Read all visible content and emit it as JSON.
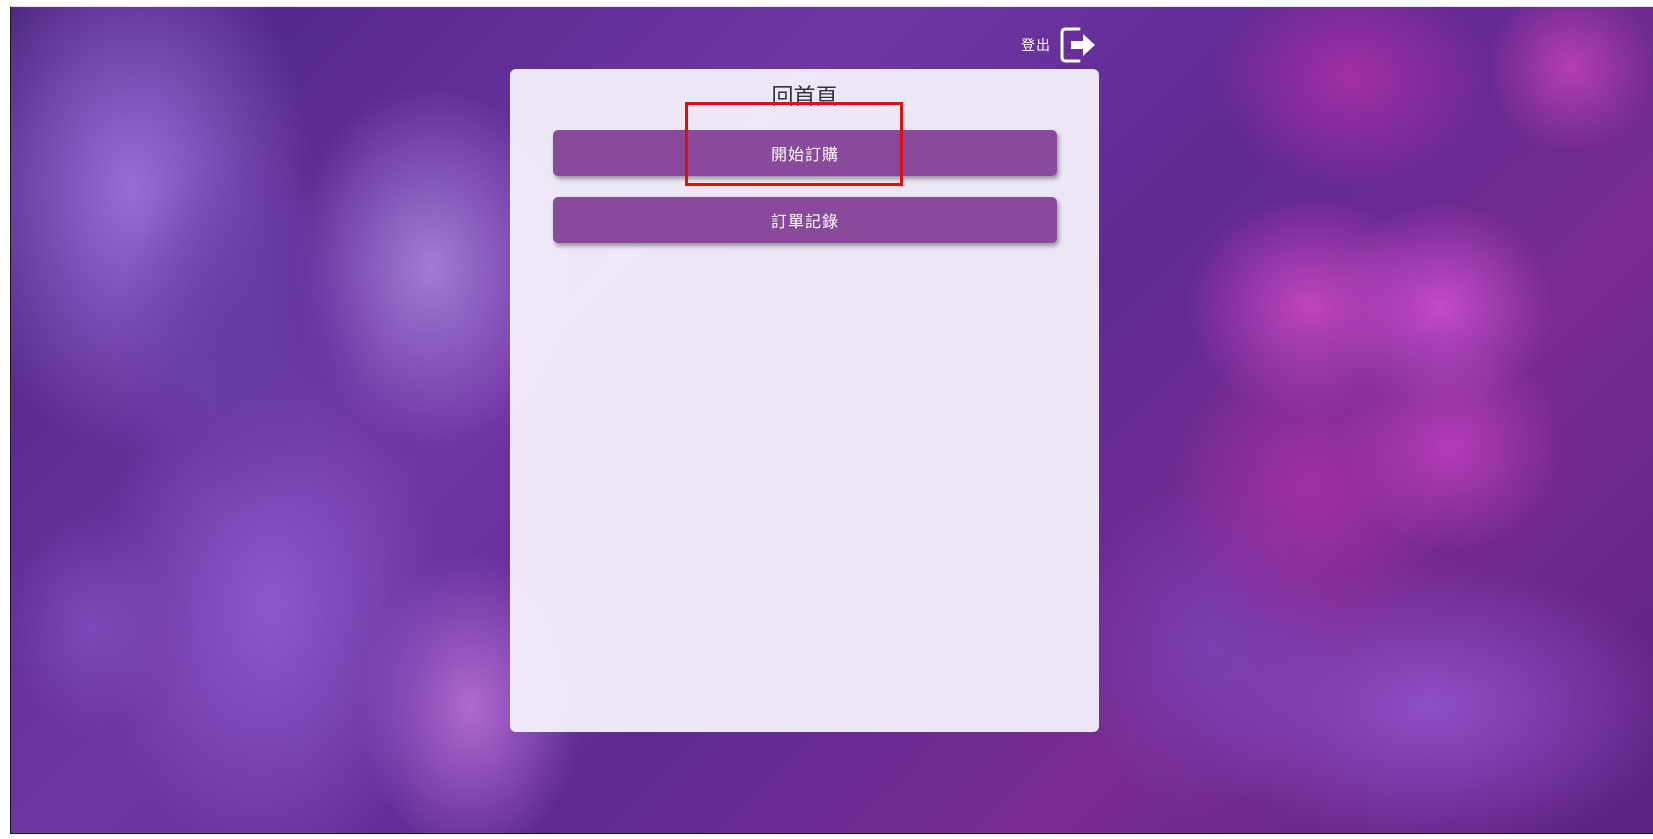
{
  "header": {
    "logout_label": "登出",
    "logout_icon": "logout-arrow-icon"
  },
  "panel": {
    "title": "回首頁",
    "buttons": [
      {
        "label": "開始訂購"
      },
      {
        "label": "訂單記錄"
      }
    ]
  },
  "colors": {
    "button_bg": "#8a4a9c",
    "button_text": "#ffffff",
    "highlight": "#e01010",
    "panel_bg": "#f8f4fc"
  }
}
